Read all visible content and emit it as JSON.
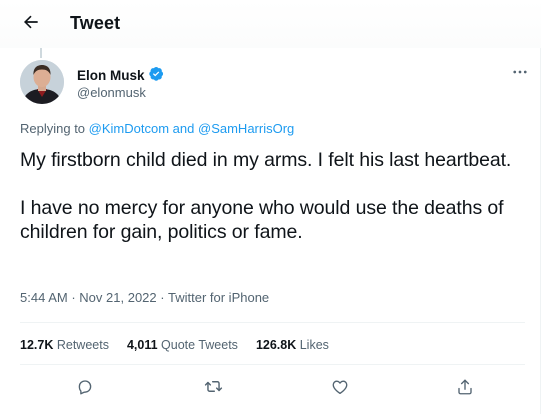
{
  "header": {
    "title": "Tweet",
    "back_icon": "arrow-left-icon"
  },
  "author": {
    "name": "Elon Musk",
    "handle": "@elonmusk",
    "verified_icon": "verified-badge-icon",
    "more_icon": "more-horizontal-icon"
  },
  "replying": {
    "prefix": "Replying to",
    "user1": "@KimDotcom",
    "connector": "and",
    "user2": "@SamHarrisOrg"
  },
  "tweet": {
    "paragraph1": "My firstborn child died in my arms. I felt his last heartbeat.",
    "paragraph2": "I have no mercy for anyone who would use the deaths of children for gain, politics or fame."
  },
  "meta": {
    "time": "5:44 AM",
    "sep1": "·",
    "date": "Nov 21, 2022",
    "sep2": "·",
    "source": "Twitter for iPhone"
  },
  "stats": {
    "retweets_count": "12.7K",
    "retweets_label": "Retweets",
    "quotes_count": "4,011",
    "quotes_label": "Quote Tweets",
    "likes_count": "126.8K",
    "likes_label": "Likes"
  },
  "actions": [
    "reply-icon",
    "retweet-icon",
    "like-icon",
    "share-icon"
  ],
  "colors": {
    "accent": "#1d9bf0",
    "text": "#0f1419",
    "secondary": "#536471",
    "divider": "#eff3f4"
  }
}
